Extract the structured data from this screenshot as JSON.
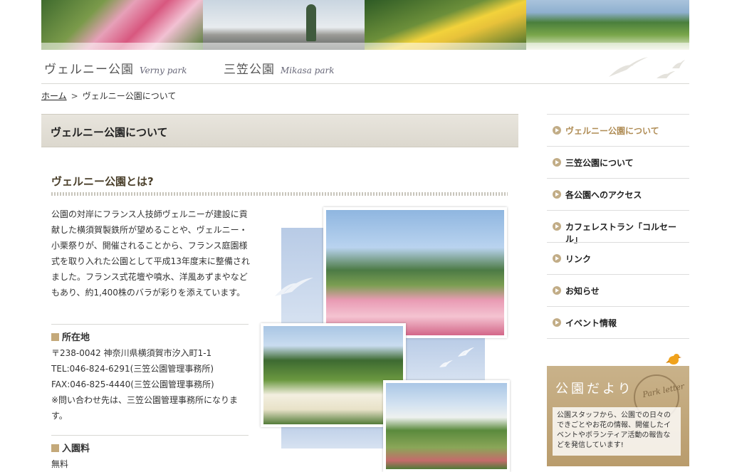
{
  "header": {
    "parks": [
      {
        "ja": "ヴェルニー公園",
        "en": "Verny park"
      },
      {
        "ja": "三笠公園",
        "en": "Mikasa park"
      }
    ]
  },
  "breadcrumb": {
    "home": "ホーム",
    "separator": ">",
    "current": "ヴェルニー公園について"
  },
  "page": {
    "title": "ヴェルニー公園について",
    "section_title": "ヴェルニー公園とは?",
    "description": "公園の対岸にフランス人技師ヴェルニーが建設に貢献した横須賀製鉄所が望めることや、ヴェルニー・小栗祭りが、開催されることから、フランス庭園様式を取り入れた公園として平成13年度末に整備されました。フランス式花壇や噴水、洋風あずまやなどもあり、約1,400株のバラが彩りを添えています。",
    "location_title": "所在地",
    "location_lines": [
      "〒238-0042 神奈川県横須賀市汐入町1-1",
      "TEL:046-824-6291(三笠公園管理事務所)",
      "FAX:046-825-4440(三笠公園管理事務所)",
      "※問い合わせ先は、三笠公園管理事務所になります。"
    ],
    "fee_title": "入園料",
    "fee_value": "無料"
  },
  "sidebar": {
    "items": [
      {
        "label": "ヴェルニー公園について",
        "active": true
      },
      {
        "label": "三笠公園について"
      },
      {
        "label": "各公園へのアクセス"
      },
      {
        "label": "カフェレストラン「コルセール」"
      },
      {
        "label": "リンク"
      },
      {
        "label": "お知らせ"
      },
      {
        "label": "イベント情報"
      }
    ]
  },
  "letter": {
    "title": "公園だより",
    "stamp": "Park letter",
    "message": "公園スタッフから、公園での日々のできごとやお花の情報、開催したイベントやボランティア活動の報告などを発信しています!"
  },
  "colors": {
    "accent": "#b08d56",
    "title_bar": "#e3e0d8",
    "bullet": "#c2ad87"
  }
}
